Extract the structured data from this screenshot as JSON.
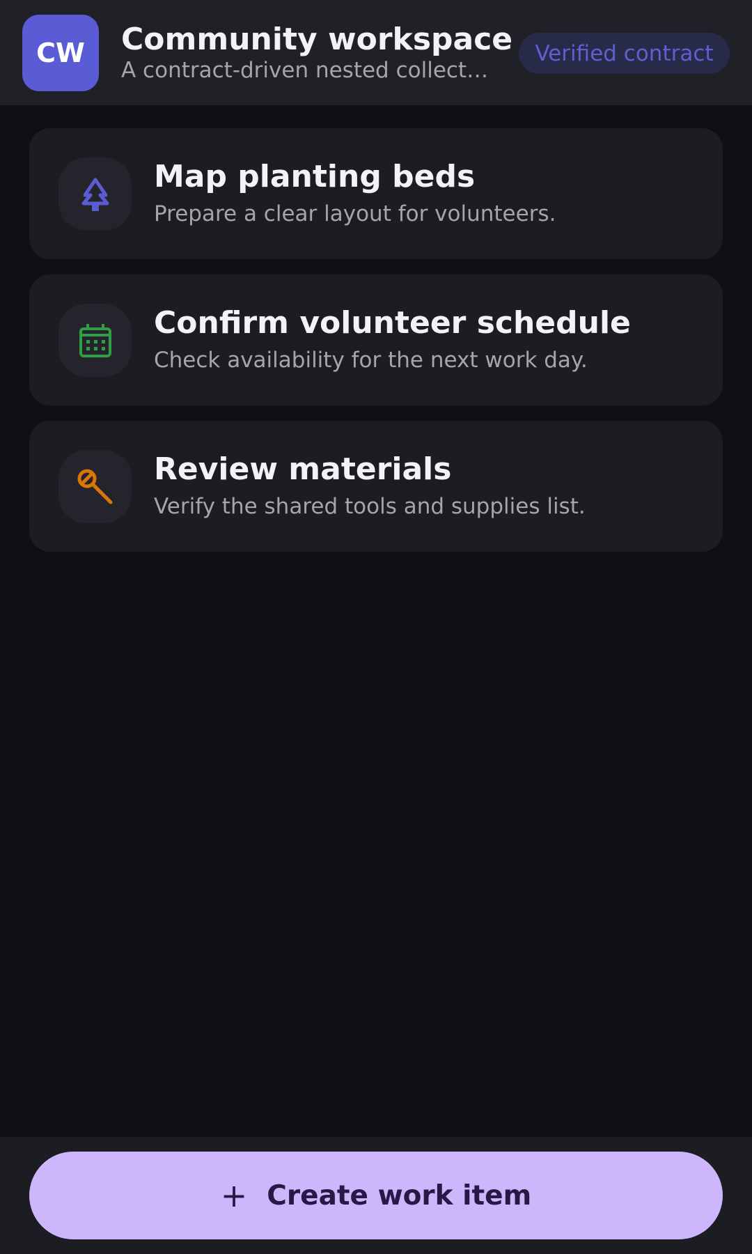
{
  "header": {
    "avatar_initials": "CW",
    "title": "Community workspace",
    "subtitle": "A contract-driven nested collect…",
    "badge": "Verified contract"
  },
  "items": [
    {
      "title": "Map planting beds",
      "description": "Prepare a clear layout for volunteers.",
      "icon": "tree-icon",
      "icon_color": "#5b5bd6"
    },
    {
      "title": "Confirm volunteer schedule",
      "description": "Check availability for the next work day.",
      "icon": "calendar-icon",
      "icon_color": "#2f9e44"
    },
    {
      "title": "Review materials",
      "description": "Verify the shared tools and supplies list.",
      "icon": "wrench-icon",
      "icon_color": "#d97706"
    }
  ],
  "footer": {
    "create_icon": "plus-icon",
    "create_label": "Create work item"
  },
  "colors": {
    "background": "#0f1014",
    "accent": "#5b5bd6",
    "button": "#cdb6fb"
  }
}
